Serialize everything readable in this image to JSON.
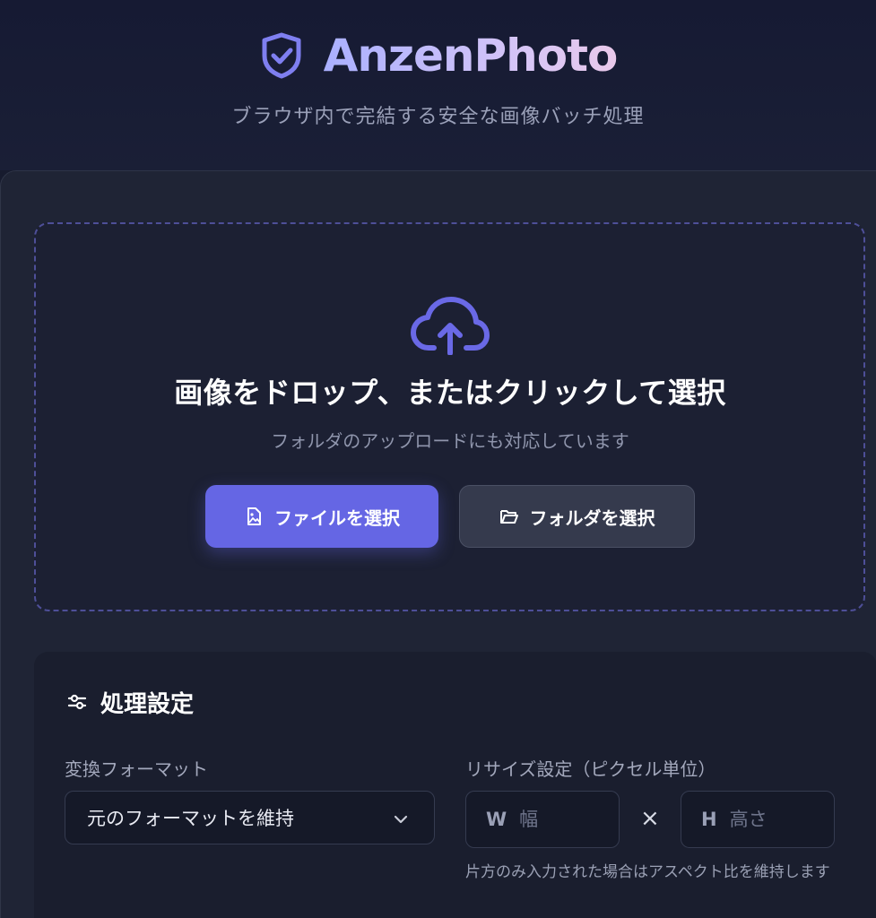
{
  "header": {
    "app_title": "AnzenPhoto",
    "subtitle": "ブラウザ内で完結する安全な画像バッチ処理",
    "logo_icon": "shield-check-icon",
    "accent_color": "#6566e4"
  },
  "dropzone": {
    "icon": "cloud-upload-icon",
    "title": "画像をドロップ、またはクリックして選択",
    "subtitle": "フォルダのアップロードにも対応しています",
    "select_files_label": "ファイルを選択",
    "select_files_icon": "image-file-icon",
    "select_folder_label": "フォルダを選択",
    "select_folder_icon": "folder-open-icon"
  },
  "settings": {
    "title": "処理設定",
    "title_icon": "sliders-icon",
    "format_label": "変換フォーマット",
    "format_selected": "元のフォーマットを維持",
    "resize_label": "リサイズ設定（ピクセル単位）",
    "width_prefix": "W",
    "width_placeholder": "幅",
    "height_prefix": "H",
    "height_placeholder": "高さ",
    "times_symbol": "×",
    "resize_hint": "片方のみ入力された場合はアスペクト比を維持します"
  }
}
